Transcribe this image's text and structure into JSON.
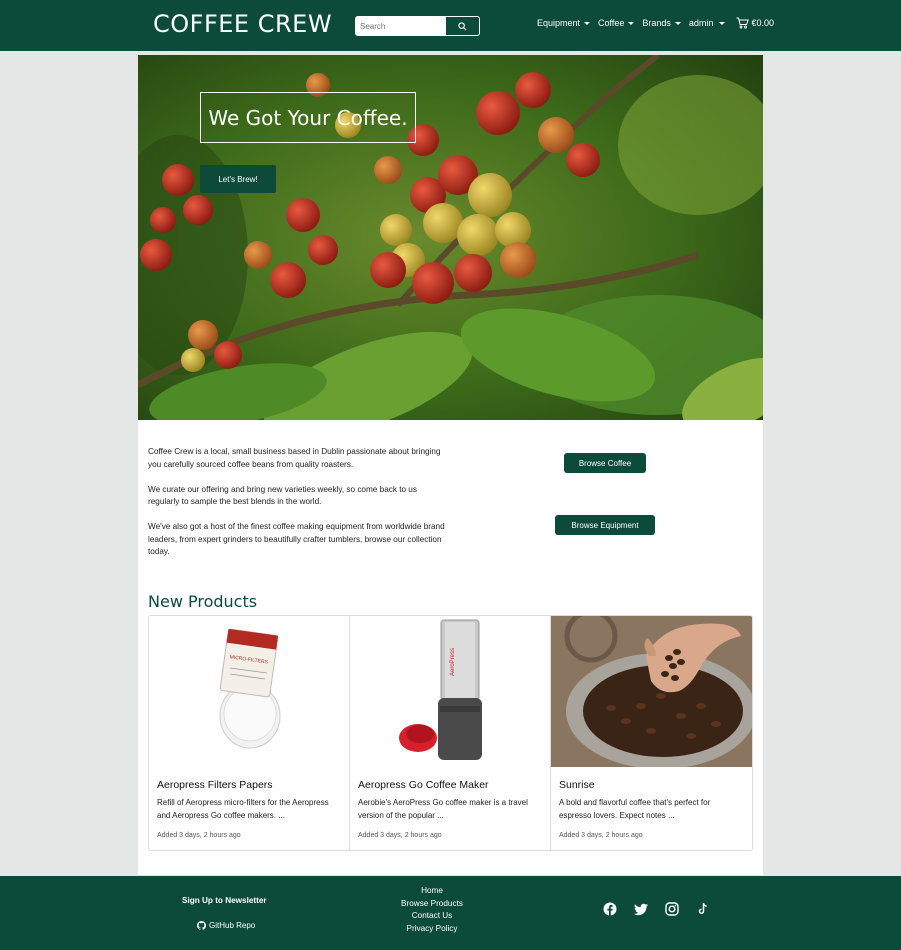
{
  "nav": {
    "brand": "COFFEE CREW",
    "search_placeholder": "Search",
    "items": [
      {
        "label": "Equipment"
      },
      {
        "label": "Coffee"
      },
      {
        "label": "Brands"
      },
      {
        "label": "admin"
      }
    ],
    "cart_total": "€0.00"
  },
  "hero": {
    "title": "We Got Your Coffee.",
    "button": "Let's Brew!"
  },
  "intro": {
    "paragraphs": [
      "Coffee Crew is a local, small business based in Dublin passionate about bringing you carefully sourced coffee beans from quality roasters.",
      "We curate our offering and bring new varieties weekly, so come back to us regularly to sample the best blends in the world.",
      "We've also got a host of the finest coffee making equipment from worldwide brand leaders, from expert grinders to beautifully crafter tumblers, browse our collection today."
    ],
    "browse_coffee": "Browse Coffee",
    "browse_equipment": "Browse Equipment"
  },
  "new_products": {
    "title": "New Products",
    "items": [
      {
        "name": "Aeropress Filters Papers",
        "desc": "Refill of Aeropress micro-filters for the Aeropress and Aeropress Go coffee makers. ...",
        "date": "Added 3 days, 2 hours ago"
      },
      {
        "name": "Aeropress Go Coffee Maker",
        "desc": "Aerobie's AeroPress Go coffee maker is a travel version of the popular ...",
        "date": "Added 3 days, 2 hours ago"
      },
      {
        "name": "Sunrise",
        "desc": "A bold and flavorful coffee that's perfect for espresso lovers. Expect notes ...",
        "date": "Added 3 days, 2 hours ago"
      }
    ]
  },
  "footer": {
    "newsletter": "Sign Up to Newsletter",
    "github": "GitHub Repo",
    "links": [
      "Home",
      "Browse Products",
      "Contact Us",
      "Privacy Policy"
    ],
    "socials": [
      "facebook-icon",
      "twitter-icon",
      "instagram-icon",
      "tiktok-icon"
    ]
  },
  "colors": {
    "brand_green": "#0c4a3a",
    "page_bg": "#e4e7e6"
  }
}
